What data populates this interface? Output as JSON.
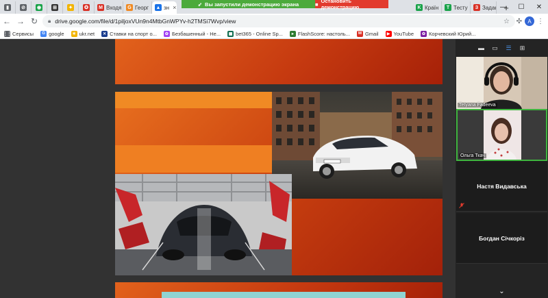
{
  "tabs": [
    {
      "name": "tab-1",
      "fav_color": "#5f6368",
      "fav_glyph": "▮",
      "label": "",
      "mini": true
    },
    {
      "name": "tab-2",
      "fav_color": "#5f6368",
      "fav_glyph": "⊘",
      "label": "",
      "mini": true
    },
    {
      "name": "tab-3",
      "fav_color": "#1aa34a",
      "fav_glyph": "◉",
      "label": "",
      "mini": true
    },
    {
      "name": "tab-4",
      "fav_color": "#333333",
      "fav_glyph": "⊞",
      "label": "",
      "mini": true
    },
    {
      "name": "tab-5",
      "fav_color": "#f2b400",
      "fav_glyph": "✦",
      "label": "",
      "mini": true
    },
    {
      "name": "tab-6",
      "fav_color": "#d93025",
      "fav_glyph": "✪",
      "label": "",
      "mini": true
    },
    {
      "name": "tab-gmail",
      "fav_color": "#d93025",
      "fav_glyph": "M",
      "label": "Входя",
      "mini": false
    },
    {
      "name": "tab-georg",
      "fav_color": "#f08a24",
      "fav_glyph": "G",
      "label": "Георг",
      "mini": false
    },
    {
      "name": "tab-drive",
      "fav_color": "#1a73e8",
      "fav_glyph": "▲",
      "label": "зн",
      "mini": false,
      "active": true
    },
    {
      "name": "tab-krai",
      "fav_color": "#1aa34a",
      "fav_glyph": "K",
      "label": "Країн",
      "mini": false
    },
    {
      "name": "tab-test",
      "fav_color": "#1aa34a",
      "fav_glyph": "T",
      "label": "Тесту",
      "mini": false
    },
    {
      "name": "tab-zadan",
      "fav_color": "#d93025",
      "fav_glyph": "З",
      "label": "Задан",
      "mini": false
    }
  ],
  "share_banner": {
    "message": "Вы запустили демонстрацию экрана",
    "stop": "Остановить демонстрацию"
  },
  "address": {
    "url": "drive.google.com/file/d/1piljoxVUn9n4MtbGnWPYv-h2TMSi7Wvp/view",
    "avatar_letter": "A"
  },
  "bookmarks": [
    {
      "label": "Сервисы",
      "color": "#5f6368",
      "glyph": "⋮⋮"
    },
    {
      "label": "google",
      "color": "#4285f4",
      "glyph": "G"
    },
    {
      "label": "ukr.net",
      "color": "#f2b400",
      "glyph": "✳"
    },
    {
      "label": "Ставки на спорт о...",
      "color": "#1a3d8f",
      "glyph": "✕"
    },
    {
      "label": "Безбашенный - Не...",
      "color": "#a142f4",
      "glyph": "✿"
    },
    {
      "label": "bet365 - Online Sp...",
      "color": "#126e51",
      "glyph": "▦"
    },
    {
      "label": "FlashScore: настоль...",
      "color": "#2e7d32",
      "glyph": "▸"
    },
    {
      "label": "Gmail",
      "color": "#d93025",
      "glyph": "M"
    },
    {
      "label": "YouTube",
      "color": "#ff0000",
      "glyph": "▶"
    },
    {
      "label": "Корчевский Юрий...",
      "color": "#7b1fa2",
      "glyph": "✿"
    }
  ],
  "participants": {
    "video": [
      {
        "name": "Tetyana Fadeeva"
      },
      {
        "name": "Ольга Ткач"
      }
    ],
    "names": [
      {
        "name": "Настя Видавська",
        "muted": true
      },
      {
        "name": "Богдан Січкоріз",
        "muted": false
      }
    ]
  },
  "colors": {
    "slide_orange": "#e8701f",
    "slide_red": "#a3210a",
    "share_green": "#4caa3c",
    "share_red": "#e23b2e",
    "active_speaker": "#3fb53f"
  }
}
